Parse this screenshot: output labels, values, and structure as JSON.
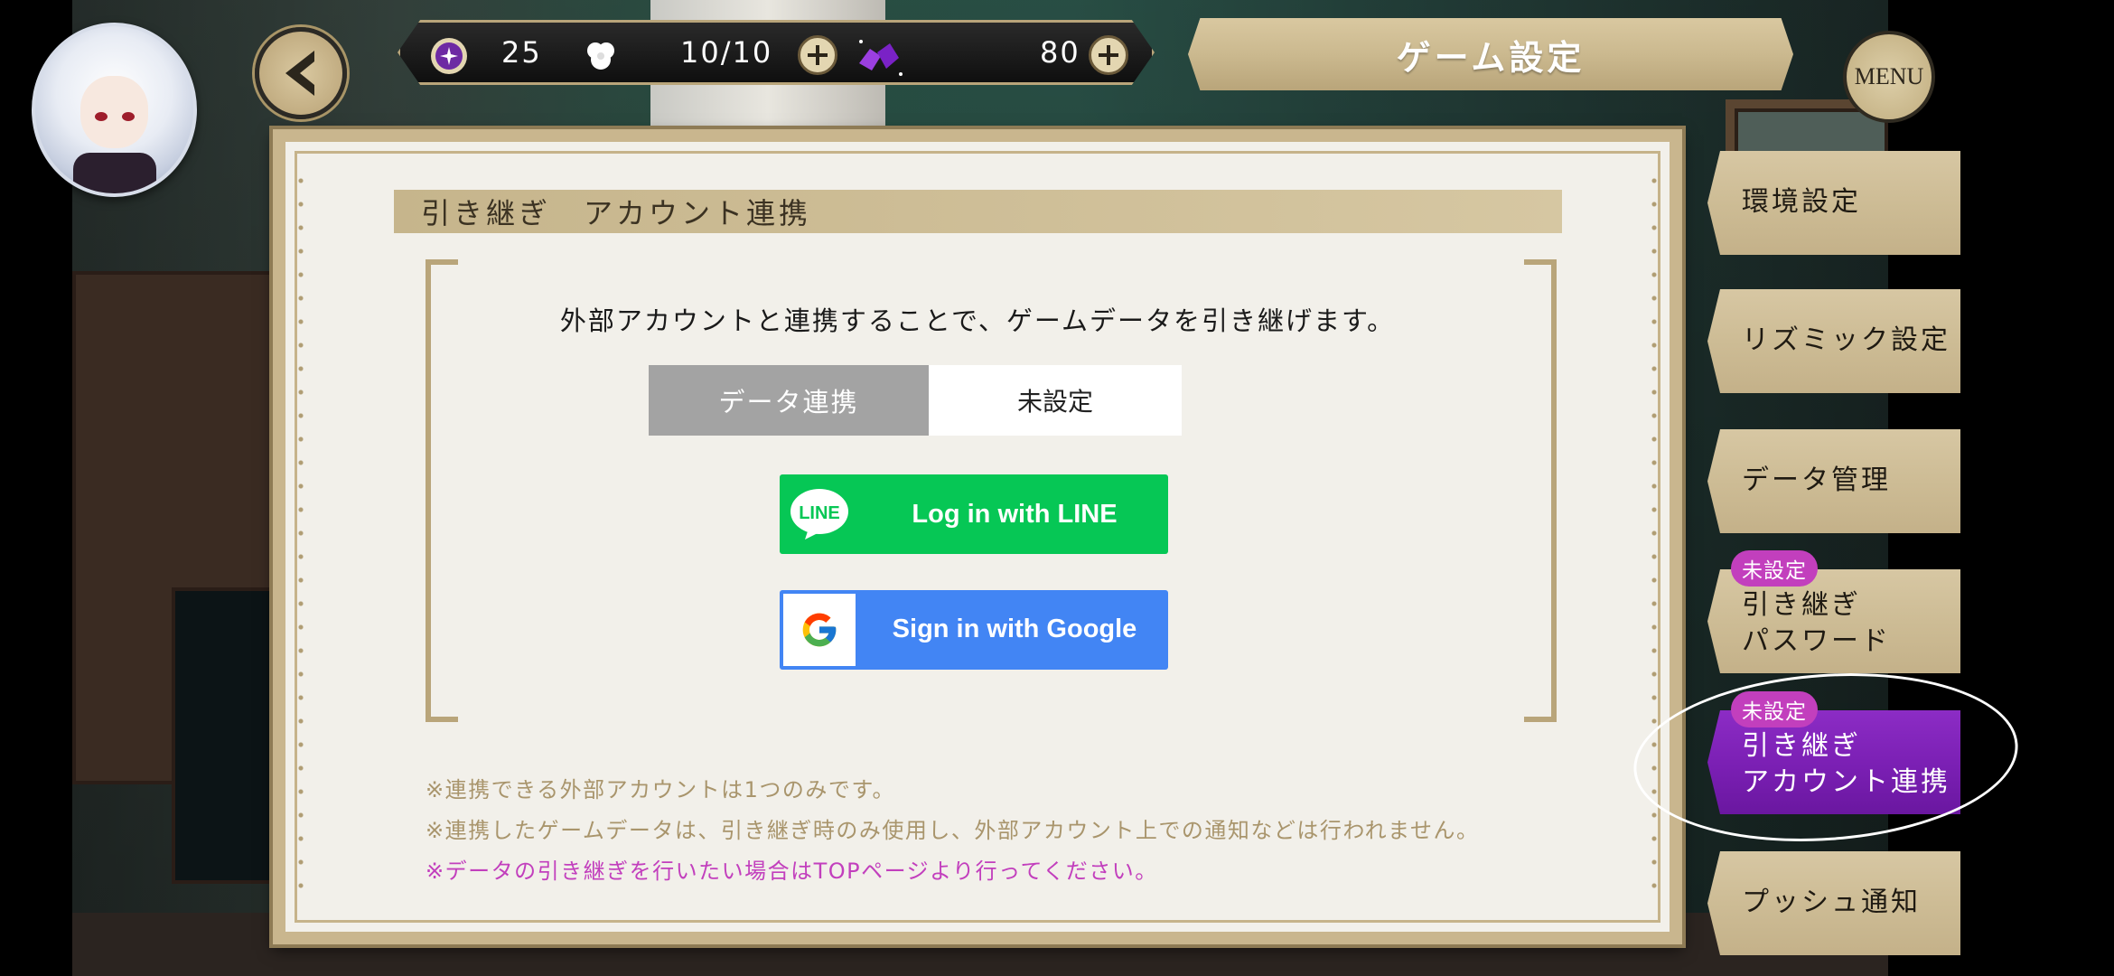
{
  "header": {
    "title": "ゲーム設定",
    "menu_label": "MENU"
  },
  "resources": {
    "orb_count": "25",
    "stamina": "10/10",
    "gem_count": "80"
  },
  "panel": {
    "section_title": "引き継ぎ　アカウント連携",
    "description": "外部アカウントと連携することで、ゲームデータを引き継げます。",
    "status_label": "データ連携",
    "status_value": "未設定",
    "line_button": "Log in with LINE",
    "line_logo_text": "LINE",
    "google_button": "Sign in with Google",
    "notes": [
      "※連携できる外部アカウントは1つのみです。",
      "※連携したゲームデータは、引き継ぎ時のみ使用し、外部アカウント上での通知などは行われません。"
    ],
    "note_pink": "※データの引き継ぎを行いたい場合はTOPページより行ってください。"
  },
  "sidebar": {
    "items": [
      {
        "label_line1": "環境設定"
      },
      {
        "label_line1": "リズミック設定"
      },
      {
        "label_line1": "データ管理"
      },
      {
        "badge": "未設定",
        "label_line1": "引き継ぎ",
        "label_line2": "パスワード"
      },
      {
        "badge": "未設定",
        "label_line1": "引き継ぎ",
        "label_line2": "アカウント連携"
      },
      {
        "label_line1": "プッシュ通知"
      }
    ],
    "active_index": 4
  },
  "colors": {
    "line_green": "#06c755",
    "google_blue": "#4285f4",
    "accent_purple": "#7a1fb3",
    "badge_pink": "#c23fbd",
    "frame_tan": "#c9b68e"
  },
  "icons": [
    "back-arrow-icon",
    "orb-icon",
    "stamina-icon",
    "plus-icon",
    "gem-icon",
    "line-logo-icon",
    "google-logo-icon"
  ]
}
